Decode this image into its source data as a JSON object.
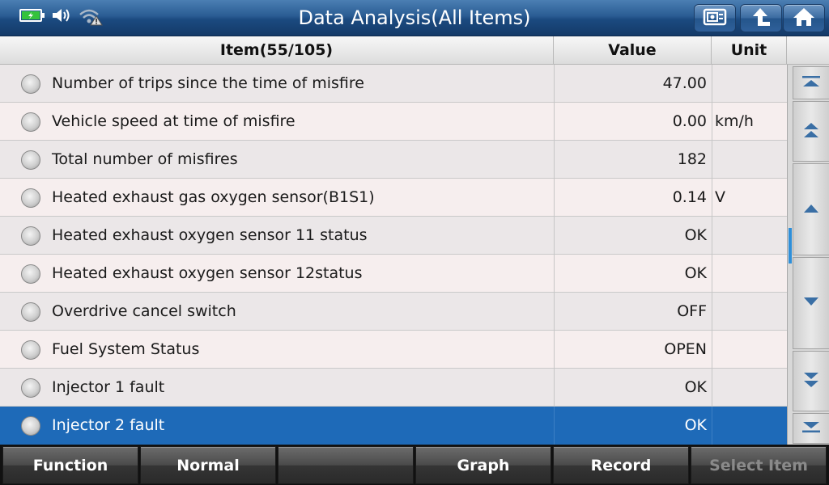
{
  "window": {
    "title": "Data Analysis(All Items)"
  },
  "status_icons": [
    "battery-charging-icon",
    "speaker-icon",
    "wifi-warning-icon"
  ],
  "title_buttons": [
    "screenshot-icon",
    "back-arrow-icon",
    "home-icon"
  ],
  "table": {
    "headers": {
      "item": "Item(55/105)",
      "value": "Value",
      "unit": "Unit"
    },
    "rows": [
      {
        "name": "Number of trips since the time of misfire",
        "value": "47.00",
        "unit": ""
      },
      {
        "name": "Vehicle speed at time of misfire",
        "value": "0.00",
        "unit": "km/h"
      },
      {
        "name": "Total number of misfires",
        "value": "182",
        "unit": ""
      },
      {
        "name": "Heated exhaust gas oxygen sensor(B1S1)",
        "value": "0.14",
        "unit": "V"
      },
      {
        "name": "Heated exhaust oxygen sensor 11 status",
        "value": "OK",
        "unit": ""
      },
      {
        "name": "Heated exhaust oxygen sensor 12status",
        "value": "OK",
        "unit": ""
      },
      {
        "name": "Overdrive cancel switch",
        "value": "OFF",
        "unit": ""
      },
      {
        "name": "Fuel System Status",
        "value": "OPEN",
        "unit": ""
      },
      {
        "name": "Injector 1 fault",
        "value": "OK",
        "unit": ""
      },
      {
        "name": "Injector 2 fault",
        "value": "OK",
        "unit": ""
      }
    ],
    "selected_index": 9
  },
  "scroll_buttons": [
    "scroll-top-icon",
    "page-up-icon",
    "line-up-icon",
    "line-down-icon",
    "page-down-icon",
    "scroll-bottom-icon"
  ],
  "toolbar": {
    "function": "Function",
    "normal": "Normal",
    "blank": "",
    "graph": "Graph",
    "record": "Record",
    "select_item": "Select Item"
  },
  "colors": {
    "title_bar": "#1b4a80",
    "selected_row": "#1e6ab8",
    "scroll_indicator": "#2e8fd9"
  }
}
